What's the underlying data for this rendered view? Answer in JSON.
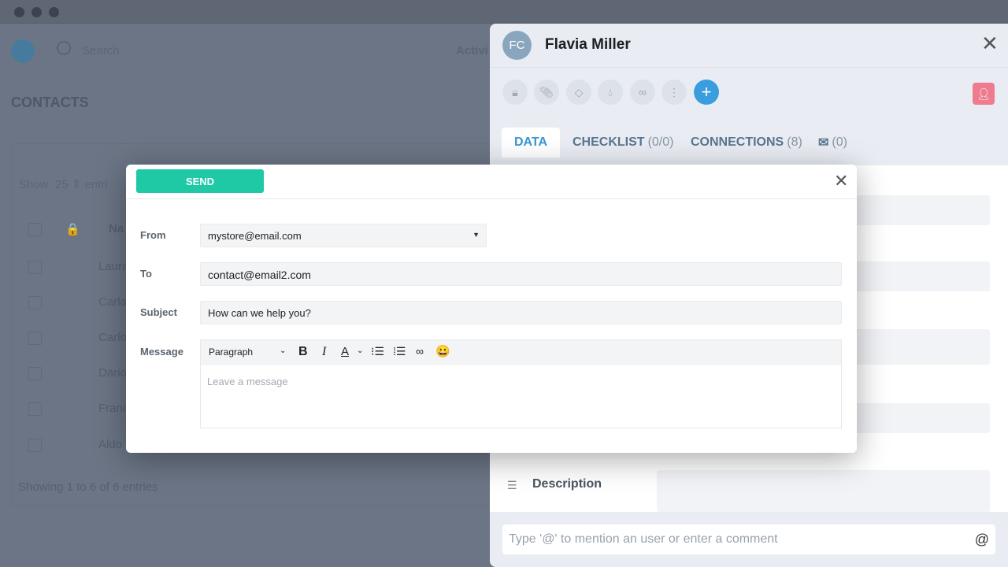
{
  "background": {
    "search_placeholder": "Search",
    "activity_label": "Activi",
    "title": "CONTACTS",
    "show_label": "Show",
    "show_value": "25",
    "entries_label": "entri",
    "name_header": "Na",
    "rows": [
      "Laura",
      "Carla",
      "Carlo",
      "Dario",
      "Franc",
      "Aldo"
    ],
    "showing": "Showing 1 to 6 of 6 entries"
  },
  "panel": {
    "avatar_initials": "FC",
    "name": "Flavia Miller",
    "toolbar_icons": [
      "lock-icon",
      "paperclip-icon",
      "tag-icon",
      "drop-icon",
      "link-icon",
      "more-icon",
      "plus-icon"
    ],
    "tabs": [
      {
        "label": "DATA",
        "count": ""
      },
      {
        "label": "CHECKLIST",
        "count": "(0/0)"
      },
      {
        "label": "CONNECTIONS",
        "count": "(8)"
      },
      {
        "label": "✉",
        "count": "(0)"
      }
    ],
    "description_label": "Description",
    "comment_placeholder": "Type '@' to mention an user or enter a comment",
    "at_symbol": "@",
    "accent": "#3a9de0",
    "pink": "#ee7b8e"
  },
  "modal": {
    "send_label": "SEND",
    "from_label": "From",
    "from_value": "mystore@email.com",
    "to_label": "To",
    "to_value": "contact@email2.com",
    "subject_label": "Subject",
    "subject_value": "How can we help you?",
    "message_label": "Message",
    "paragraph_label": "Paragraph",
    "message_placeholder": "Leave a message",
    "send_color": "#20c9a6"
  }
}
